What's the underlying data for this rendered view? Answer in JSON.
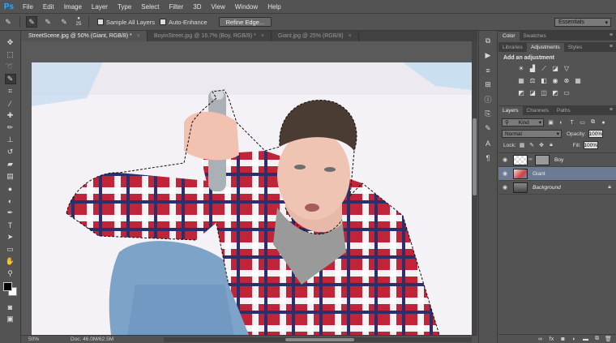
{
  "app": {
    "logo": "Ps"
  },
  "menu": [
    "File",
    "Edit",
    "Image",
    "Layer",
    "Type",
    "Select",
    "Filter",
    "3D",
    "View",
    "Window",
    "Help"
  ],
  "options": {
    "brush_size": "25",
    "sample_all_layers": "Sample All Layers",
    "auto_enhance": "Auto-Enhance",
    "refine_edge": "Refine Edge...",
    "workspace": "Essentials"
  },
  "tabs": [
    {
      "label": "StreetScene.jpg @ 50% (Giant, RGB/8) *",
      "active": true
    },
    {
      "label": "BoyinStreet.jpg @ 16.7% (Boy, RGB/8) *",
      "active": false
    },
    {
      "label": "Giant.jpg @ 25% (RGB/8)",
      "active": false
    }
  ],
  "status": {
    "zoom": "50%",
    "doc": "Doc: 46.0M/62.5M"
  },
  "color_panel": {
    "tabs": [
      "Color",
      "Swatches"
    ]
  },
  "adjustments_panel": {
    "tabs": [
      "Libraries",
      "Adjustments",
      "Styles"
    ],
    "title": "Add an adjustment"
  },
  "layers_panel": {
    "tabs": [
      "Layers",
      "Channels",
      "Paths"
    ],
    "kind": "Kind",
    "blend_mode": "Normal",
    "opacity_label": "Opacity:",
    "opacity_value": "100%",
    "lock_label": "Lock:",
    "fill_label": "Fill:",
    "fill_value": "100%",
    "layers": [
      {
        "name": "Boy",
        "selected": false,
        "italic": false,
        "thumb": "checker",
        "mask": true,
        "locked": false
      },
      {
        "name": "Giant",
        "selected": true,
        "italic": false,
        "thumb": "photo",
        "mask": false,
        "locked": false
      },
      {
        "name": "Background",
        "selected": false,
        "italic": true,
        "thumb": "dark",
        "mask": false,
        "locked": true
      }
    ]
  }
}
